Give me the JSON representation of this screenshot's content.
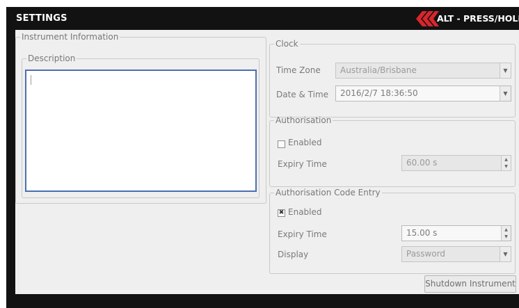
{
  "window": {
    "title": "SETTINGS",
    "alt_hint": "ALT - PRESS/HOLD"
  },
  "instrument": {
    "legend": "Instrument Information",
    "description_legend": "Description",
    "description_value": ""
  },
  "clock": {
    "legend": "Clock",
    "timezone_label": "Time Zone",
    "timezone_value": "Australia/Brisbane",
    "datetime_label": "Date & Time",
    "datetime_value": "2016/2/7 18:36:50"
  },
  "authorisation": {
    "legend": "Authorisation",
    "enabled_label": "Enabled",
    "enabled_checked": false,
    "expiry_label": "Expiry Time",
    "expiry_value": "60.00 s"
  },
  "code_entry": {
    "legend": "Authorisation Code Entry",
    "enabled_label": "Enabled",
    "enabled_checked": true,
    "expiry_label": "Expiry Time",
    "expiry_value": "15.00 s",
    "display_label": "Display",
    "display_value": "Password"
  },
  "actions": {
    "shutdown_label": "Shutdown Instrument"
  },
  "colors": {
    "titlebar": "#121212",
    "accent_chevron": "#d8262c",
    "panel": "#efefef",
    "focus_border": "#4d6fae"
  }
}
